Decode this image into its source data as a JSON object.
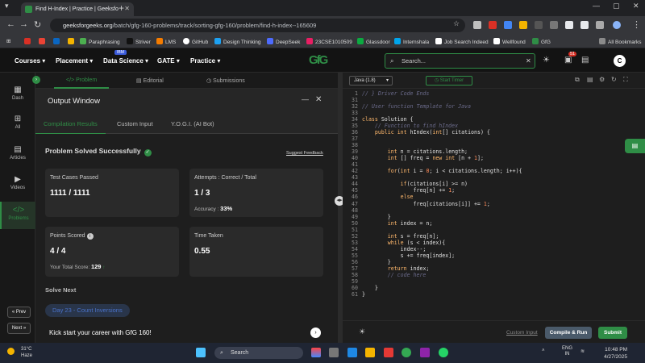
{
  "browser": {
    "tab_title": "Find H-Index | Practice | Geeksfo",
    "url_host": "geeksforgeeks.org",
    "url_path": "/batch/gfg-160-problems/track/sorting-gfg-160/problem/find-h-index--165609",
    "bookmarks": [
      "Paraphrasing",
      "Striver",
      "LMS",
      "GitHub",
      "Design Thinking",
      "DeepSeek",
      "23CSE1010509",
      "Glassdoor",
      "Internshala",
      "Job Search Indeed",
      "Wellfound",
      "GfG"
    ],
    "all_bookmarks": "All Bookmarks"
  },
  "gfg_nav": {
    "links": [
      "Courses",
      "Placement",
      "Data Science",
      "GATE",
      "Practice"
    ],
    "ibm_badge": "IBM",
    "logo": "GfG",
    "search_placeholder": "Search...",
    "notif_count": "51",
    "avatar": "C"
  },
  "rail": {
    "items": [
      "Dash",
      "All",
      "Articles",
      "Videos",
      "Problems"
    ],
    "prev": "« Prev",
    "next": "Next »"
  },
  "problem_tabs": [
    "Problem",
    "Editorial",
    "Submissions"
  ],
  "output": {
    "title": "Output Window",
    "subtabs": [
      "Compilation Results",
      "Custom Input",
      "Y.O.G.I. (AI Bot)"
    ],
    "status": "Problem Solved Successfully",
    "feedback": "Suggest Feedback",
    "cards": {
      "tests_label": "Test Cases Passed",
      "tests_value": "1111 / 1111",
      "attempts_label": "Attempts : Correct / Total",
      "attempts_value": "1 / 3",
      "accuracy_label": "Accuracy :",
      "accuracy_value": "33%",
      "points_label": "Points Scored",
      "points_value": "4 / 4",
      "total_label": "Your Total Score:",
      "total_value": "129",
      "time_label": "Time Taken",
      "time_value": "0.55"
    },
    "solve_next": "Solve Next",
    "next_problem": "Day 23 - Count Inversions",
    "kickstart": "Kick start your career with GfG 160!"
  },
  "editor": {
    "language": "Java (1.8)",
    "timer": "Start Timer",
    "custom_input": "Custom Input",
    "compile": "Compile & Run",
    "submit": "Submit",
    "lines": [
      {
        "n": "1",
        "t": "// } Driver Code Ends"
      },
      {
        "n": "31",
        "t": ""
      },
      {
        "n": "32",
        "t": "// User function Template for Java"
      },
      {
        "n": "33",
        "t": ""
      },
      {
        "n": "34",
        "t": "class Solution {"
      },
      {
        "n": "35",
        "t": "    // Function to find hIndex"
      },
      {
        "n": "36",
        "t": "    public int hIndex(int[] citations) {"
      },
      {
        "n": "37",
        "t": ""
      },
      {
        "n": "38",
        "t": ""
      },
      {
        "n": "39",
        "t": "        int n = citations.length;"
      },
      {
        "n": "40",
        "t": "        int [] freq = new int [n + 1];"
      },
      {
        "n": "41",
        "t": ""
      },
      {
        "n": "42",
        "t": "        for(int i = 0; i < citations.length; i++){"
      },
      {
        "n": "43",
        "t": ""
      },
      {
        "n": "44",
        "t": "            if(citations[i] >= n)"
      },
      {
        "n": "45",
        "t": "                freq[n] += 1;"
      },
      {
        "n": "46",
        "t": "            else"
      },
      {
        "n": "47",
        "t": "                freq[citations[i]] += 1;"
      },
      {
        "n": "48",
        "t": ""
      },
      {
        "n": "49",
        "t": "        }"
      },
      {
        "n": "50",
        "t": "        int index = n;"
      },
      {
        "n": "51",
        "t": ""
      },
      {
        "n": "52",
        "t": "        int s = freq[n];"
      },
      {
        "n": "53",
        "t": "        while (s < index){"
      },
      {
        "n": "54",
        "t": "            index--;"
      },
      {
        "n": "55",
        "t": "            s += freq[index];"
      },
      {
        "n": "56",
        "t": "        }"
      },
      {
        "n": "57",
        "t": "        return index;"
      },
      {
        "n": "58",
        "t": "        // code here"
      },
      {
        "n": "59",
        "t": ""
      },
      {
        "n": "60",
        "t": "    }"
      },
      {
        "n": "61",
        "t": "}"
      }
    ]
  },
  "taskbar": {
    "temp": "31°C",
    "weather": "Haze",
    "search": "Search",
    "lang1": "ENG",
    "lang2": "IN",
    "time": "10:48 PM",
    "date": "4/27/2025"
  },
  "colors": {
    "accent": "#2f8d46",
    "link_blue": "#4a72c8"
  }
}
